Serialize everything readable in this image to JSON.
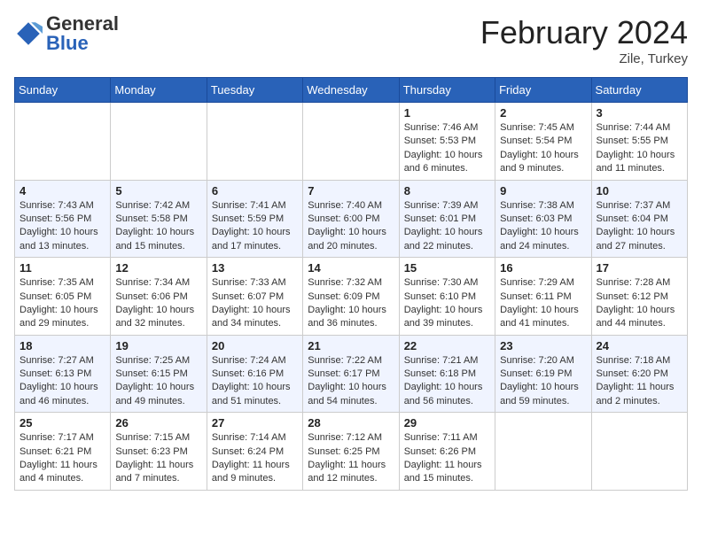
{
  "header": {
    "title": "February 2024",
    "subtitle": "Zile, Turkey",
    "logo_general": "General",
    "logo_blue": "Blue"
  },
  "days_of_week": [
    "Sunday",
    "Monday",
    "Tuesday",
    "Wednesday",
    "Thursday",
    "Friday",
    "Saturday"
  ],
  "weeks": [
    [
      {
        "day": "",
        "info": ""
      },
      {
        "day": "",
        "info": ""
      },
      {
        "day": "",
        "info": ""
      },
      {
        "day": "",
        "info": ""
      },
      {
        "day": "1",
        "info": "Sunrise: 7:46 AM\nSunset: 5:53 PM\nDaylight: 10 hours\nand 6 minutes."
      },
      {
        "day": "2",
        "info": "Sunrise: 7:45 AM\nSunset: 5:54 PM\nDaylight: 10 hours\nand 9 minutes."
      },
      {
        "day": "3",
        "info": "Sunrise: 7:44 AM\nSunset: 5:55 PM\nDaylight: 10 hours\nand 11 minutes."
      }
    ],
    [
      {
        "day": "4",
        "info": "Sunrise: 7:43 AM\nSunset: 5:56 PM\nDaylight: 10 hours\nand 13 minutes."
      },
      {
        "day": "5",
        "info": "Sunrise: 7:42 AM\nSunset: 5:58 PM\nDaylight: 10 hours\nand 15 minutes."
      },
      {
        "day": "6",
        "info": "Sunrise: 7:41 AM\nSunset: 5:59 PM\nDaylight: 10 hours\nand 17 minutes."
      },
      {
        "day": "7",
        "info": "Sunrise: 7:40 AM\nSunset: 6:00 PM\nDaylight: 10 hours\nand 20 minutes."
      },
      {
        "day": "8",
        "info": "Sunrise: 7:39 AM\nSunset: 6:01 PM\nDaylight: 10 hours\nand 22 minutes."
      },
      {
        "day": "9",
        "info": "Sunrise: 7:38 AM\nSunset: 6:03 PM\nDaylight: 10 hours\nand 24 minutes."
      },
      {
        "day": "10",
        "info": "Sunrise: 7:37 AM\nSunset: 6:04 PM\nDaylight: 10 hours\nand 27 minutes."
      }
    ],
    [
      {
        "day": "11",
        "info": "Sunrise: 7:35 AM\nSunset: 6:05 PM\nDaylight: 10 hours\nand 29 minutes."
      },
      {
        "day": "12",
        "info": "Sunrise: 7:34 AM\nSunset: 6:06 PM\nDaylight: 10 hours\nand 32 minutes."
      },
      {
        "day": "13",
        "info": "Sunrise: 7:33 AM\nSunset: 6:07 PM\nDaylight: 10 hours\nand 34 minutes."
      },
      {
        "day": "14",
        "info": "Sunrise: 7:32 AM\nSunset: 6:09 PM\nDaylight: 10 hours\nand 36 minutes."
      },
      {
        "day": "15",
        "info": "Sunrise: 7:30 AM\nSunset: 6:10 PM\nDaylight: 10 hours\nand 39 minutes."
      },
      {
        "day": "16",
        "info": "Sunrise: 7:29 AM\nSunset: 6:11 PM\nDaylight: 10 hours\nand 41 minutes."
      },
      {
        "day": "17",
        "info": "Sunrise: 7:28 AM\nSunset: 6:12 PM\nDaylight: 10 hours\nand 44 minutes."
      }
    ],
    [
      {
        "day": "18",
        "info": "Sunrise: 7:27 AM\nSunset: 6:13 PM\nDaylight: 10 hours\nand 46 minutes."
      },
      {
        "day": "19",
        "info": "Sunrise: 7:25 AM\nSunset: 6:15 PM\nDaylight: 10 hours\nand 49 minutes."
      },
      {
        "day": "20",
        "info": "Sunrise: 7:24 AM\nSunset: 6:16 PM\nDaylight: 10 hours\nand 51 minutes."
      },
      {
        "day": "21",
        "info": "Sunrise: 7:22 AM\nSunset: 6:17 PM\nDaylight: 10 hours\nand 54 minutes."
      },
      {
        "day": "22",
        "info": "Sunrise: 7:21 AM\nSunset: 6:18 PM\nDaylight: 10 hours\nand 56 minutes."
      },
      {
        "day": "23",
        "info": "Sunrise: 7:20 AM\nSunset: 6:19 PM\nDaylight: 10 hours\nand 59 minutes."
      },
      {
        "day": "24",
        "info": "Sunrise: 7:18 AM\nSunset: 6:20 PM\nDaylight: 11 hours\nand 2 minutes."
      }
    ],
    [
      {
        "day": "25",
        "info": "Sunrise: 7:17 AM\nSunset: 6:21 PM\nDaylight: 11 hours\nand 4 minutes."
      },
      {
        "day": "26",
        "info": "Sunrise: 7:15 AM\nSunset: 6:23 PM\nDaylight: 11 hours\nand 7 minutes."
      },
      {
        "day": "27",
        "info": "Sunrise: 7:14 AM\nSunset: 6:24 PM\nDaylight: 11 hours\nand 9 minutes."
      },
      {
        "day": "28",
        "info": "Sunrise: 7:12 AM\nSunset: 6:25 PM\nDaylight: 11 hours\nand 12 minutes."
      },
      {
        "day": "29",
        "info": "Sunrise: 7:11 AM\nSunset: 6:26 PM\nDaylight: 11 hours\nand 15 minutes."
      },
      {
        "day": "",
        "info": ""
      },
      {
        "day": "",
        "info": ""
      }
    ]
  ]
}
